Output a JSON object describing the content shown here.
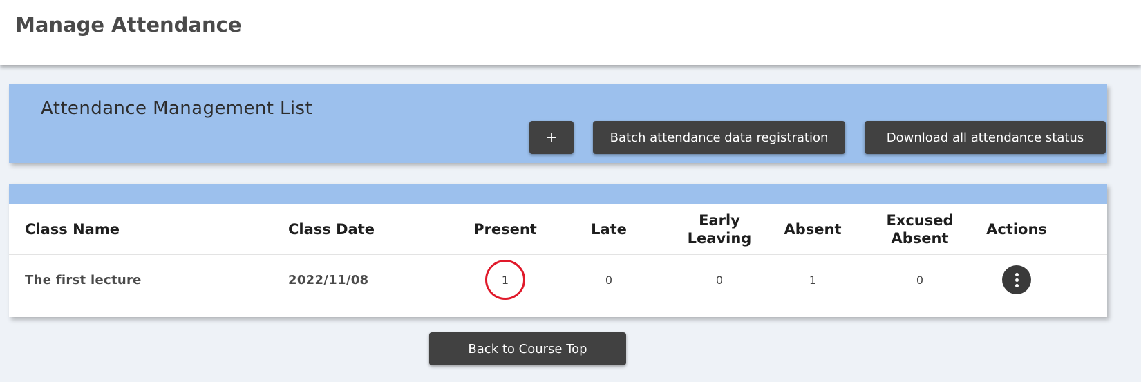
{
  "page": {
    "title": "Manage Attendance"
  },
  "panel": {
    "title": "Attendance Management List",
    "add_label": "+",
    "batch_label": "Batch attendance data registration",
    "download_label": "Download all attendance status"
  },
  "table": {
    "headers": {
      "class_name": "Class Name",
      "class_date": "Class Date",
      "present": "Present",
      "late": "Late",
      "early_leaving_1": "Early",
      "early_leaving_2": "Leaving",
      "absent": "Absent",
      "excused_absent_1": "Excused",
      "excused_absent_2": "Absent",
      "actions": "Actions"
    },
    "rows": [
      {
        "class_name": "The first lecture",
        "class_date": "2022/11/08",
        "present": "1",
        "late": "0",
        "early_leaving": "0",
        "absent": "1",
        "excused_absent": "0"
      }
    ]
  },
  "footer": {
    "back_label": "Back to Course Top"
  },
  "colors": {
    "accent_blue": "#9cc0ed",
    "button_dark": "#414141",
    "highlight_red": "#e0192a",
    "background": "#eef2f7"
  },
  "icons": {
    "actions": "vertical-ellipsis-icon",
    "highlight": "red-circle-highlight"
  }
}
